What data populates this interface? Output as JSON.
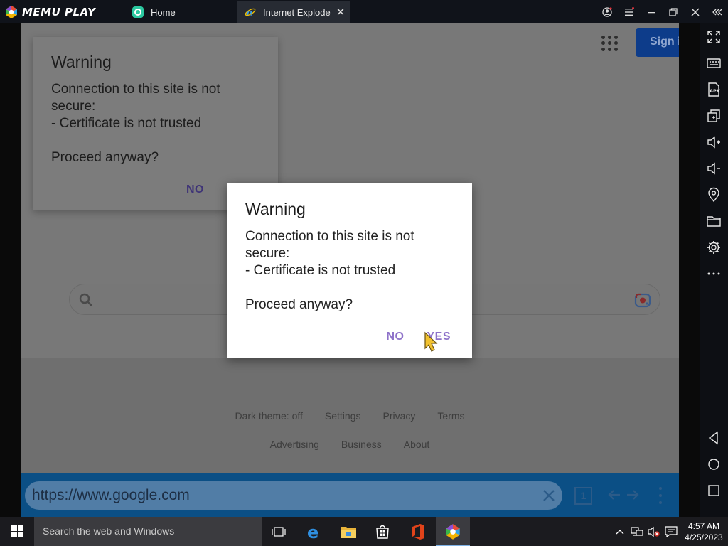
{
  "emulator": {
    "brand": "MEMU PLAY",
    "tabs": [
      {
        "label": "Home",
        "icon": "home-app-icon",
        "active": false
      },
      {
        "label": "Internet Explode",
        "icon": "internet-explorer-icon",
        "active": true
      }
    ],
    "window_controls": [
      "account-icon",
      "menu-icon",
      "minimize-icon",
      "restore-icon",
      "close-icon",
      "collapse-sidebar-icon"
    ],
    "sidebar": [
      "fullscreen-icon",
      "keyboard-icon",
      "apk-icon",
      "multi-instance-icon",
      "volume-up-icon",
      "volume-down-icon",
      "location-icon",
      "folder-icon",
      "settings-icon",
      "more-icon",
      "back-icon",
      "home-circle-icon",
      "recents-icon"
    ]
  },
  "browser": {
    "sign_in_label": "Sign i",
    "footer_row1": [
      "Dark theme: off",
      "Settings",
      "Privacy",
      "Terms"
    ],
    "footer_row2": [
      "Advertising",
      "Business",
      "About"
    ],
    "url": "https://www.google.com",
    "tab_count": "1"
  },
  "dialog_background": {
    "title": "Warning",
    "message": "Connection to this site is not secure:\n - Certificate is not trusted\n\nProceed anyway?",
    "no_label": "NO"
  },
  "dialog": {
    "title": "Warning",
    "message": "Connection to this site is not secure:\n - Certificate is not trusted\n\nProceed anyway?",
    "no_label": "NO",
    "yes_label": "YES",
    "button_color": "#8e72c9"
  },
  "taskbar": {
    "search_placeholder": "Search the web and Windows",
    "apps": [
      "task-view-icon",
      "edge-icon",
      "file-explorer-icon",
      "store-icon",
      "office-icon",
      "memu-icon"
    ],
    "time": "4:57 AM",
    "date": "4/25/2023"
  }
}
